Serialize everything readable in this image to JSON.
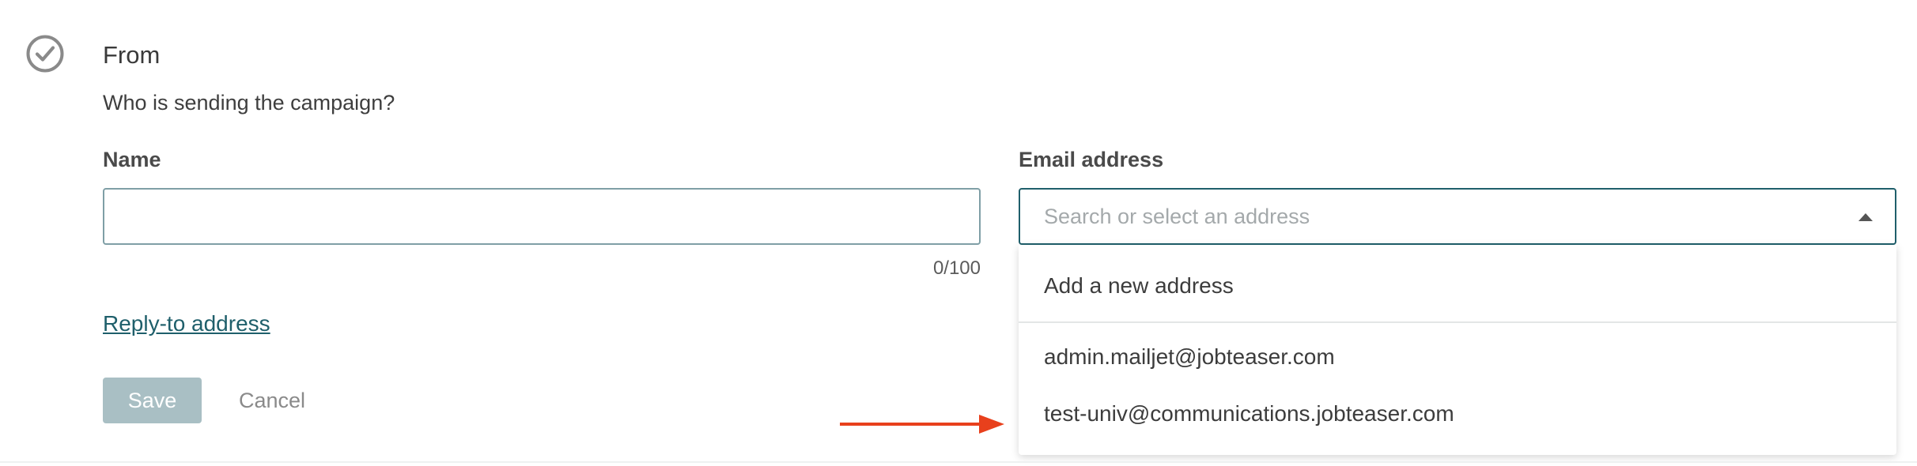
{
  "section": {
    "title": "From",
    "subtitle": "Who is sending the campaign?"
  },
  "name_field": {
    "label": "Name",
    "value": "",
    "counter": "0/100"
  },
  "email_field": {
    "label": "Email address",
    "placeholder": "Search or select an address",
    "options": {
      "add_new": "Add a new address",
      "address_1": "admin.mailjet@jobteaser.com",
      "address_2": "test-univ@communications.jobteaser.com"
    }
  },
  "reply_to_link": "Reply-to address",
  "actions": {
    "save_label": "Save",
    "cancel_label": "Cancel"
  },
  "icons": {
    "status": "check-circle-icon",
    "dropdown": "caret-up-icon",
    "annotation": "arrow-right-icon"
  },
  "colors": {
    "accent": "#1f5f6b",
    "save_disabled": "#a9bfc4",
    "annotation_arrow": "#e8401c"
  }
}
